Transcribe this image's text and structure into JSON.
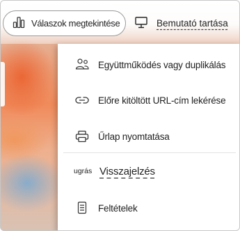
{
  "toolbar": {
    "view_responses_label": "Válaszok megtekintése",
    "present_label": "Bemutató tartása"
  },
  "menu": {
    "items": [
      {
        "label": "Együttműködés vagy duplikálás",
        "icon": "people-icon"
      },
      {
        "label": "Előre kitöltött URL-cím lekérése",
        "icon": "link-icon"
      },
      {
        "label": "Űrlap nyomtatása",
        "icon": "printer-icon"
      },
      {
        "prefix": "ugrás",
        "label": "Visszajelzés"
      },
      {
        "label": "Feltételek",
        "icon": "document-icon"
      }
    ]
  }
}
